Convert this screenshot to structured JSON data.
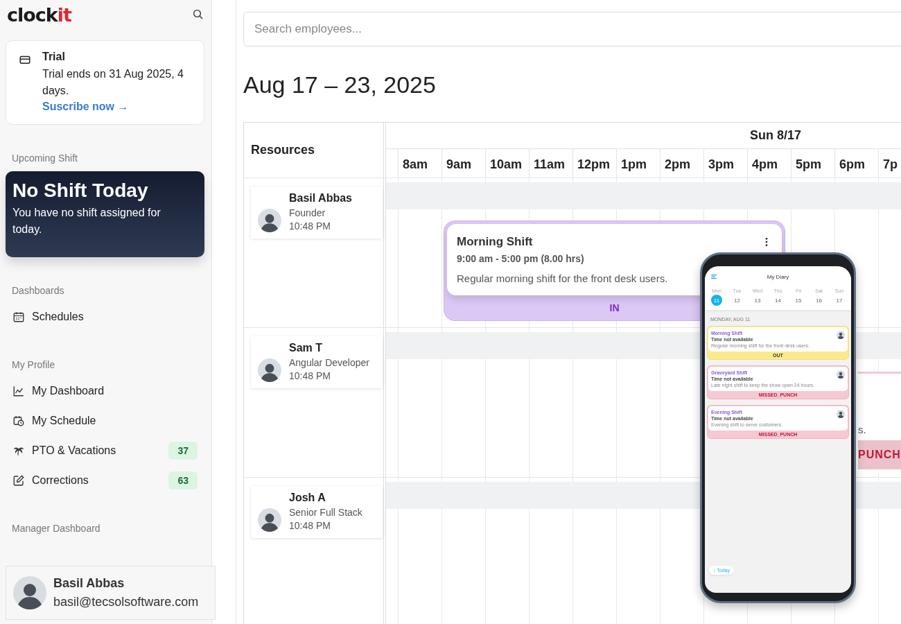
{
  "sidebar": {
    "logo": {
      "main": "clock",
      "accent": "it"
    },
    "trial": {
      "title": "Trial",
      "text": "Trial ends on 31 Aug 2025, 4 days.",
      "link": "Suscribe now →"
    },
    "upcoming_shift": {
      "label": "Upcoming Shift",
      "title": "No Shift Today",
      "text": "You have no shift assigned for today."
    },
    "sections": [
      {
        "title": "Dashboards",
        "items": [
          {
            "label": "Schedules",
            "kind": "calendar"
          }
        ]
      },
      {
        "title": "My Profile",
        "items": [
          {
            "label": "My Dashboard",
            "kind": "chart"
          },
          {
            "label": "My Schedule",
            "kind": "clock"
          },
          {
            "label": "PTO & Vacations",
            "kind": "palm",
            "badge": "37"
          },
          {
            "label": "Corrections",
            "kind": "edit",
            "badge": "63"
          }
        ]
      },
      {
        "title": "Manager Dashboard"
      }
    ],
    "user": {
      "name": "Basil Abbas",
      "email": "basil@tecsolsoftware.com"
    }
  },
  "main": {
    "search": {
      "placeholder": "Search employees..."
    },
    "title": "Aug 17 – 23, 2025",
    "schedule": {
      "resources_heading": "Resources",
      "day": "Sun 8/17",
      "hours": [
        "8am",
        "9am",
        "10am",
        "11am",
        "12pm",
        "1pm",
        "2pm",
        "3pm",
        "4pm",
        "5pm",
        "6pm",
        "7p"
      ],
      "rows": [
        {
          "name": "Basil Abbas",
          "role": "Founder",
          "time": "10:48 PM",
          "shifts": [
            {
              "kind": "in",
              "title": "Morning Shift",
              "time": "9:00 am - 5:00 pm (8.00 hrs)",
              "description": "Regular morning shift for the front desk users.",
              "status": "IN"
            }
          ]
        },
        {
          "name": "Sam T",
          "role": "Angular Developer",
          "time": "10:48 PM",
          "shifts": [
            {
              "kind": "missed",
              "description": "s.",
              "status": "PUNCH"
            }
          ]
        },
        {
          "name": "Josh A",
          "role": "Senior Full Stack",
          "time": "10:48 PM",
          "shifts": []
        }
      ]
    }
  },
  "phone": {
    "title": "My Diary",
    "days": [
      {
        "weekday": "Mon",
        "date": "11",
        "selected": true
      },
      {
        "weekday": "Tue",
        "date": "12",
        "selected": false
      },
      {
        "weekday": "Wed",
        "date": "13",
        "selected": false
      },
      {
        "weekday": "Thu",
        "date": "14",
        "selected": false
      },
      {
        "weekday": "Fri",
        "date": "15",
        "selected": false
      },
      {
        "weekday": "Sat",
        "date": "16",
        "selected": false
      },
      {
        "weekday": "Sun",
        "date": "17",
        "selected": false
      }
    ],
    "date_heading": "MONDAY, AUG 11",
    "shifts": [
      {
        "kind": "out",
        "title": "Morning Shift",
        "time": "Time not available",
        "description": "Regular morning shift for the front desk users.",
        "status": "OUT"
      },
      {
        "kind": "missed",
        "title": "Graveyard Shift",
        "time": "Time not available",
        "description": "Late night shift to keep the show open 24 hours.",
        "status": "MISSED_PUNCH"
      },
      {
        "kind": "missed",
        "title": "Evening Shift",
        "time": "Time not available",
        "description": "Evening shift to serve customers.",
        "status": "MISSED_PUNCH"
      }
    ],
    "today_button": "↓ Today"
  }
}
